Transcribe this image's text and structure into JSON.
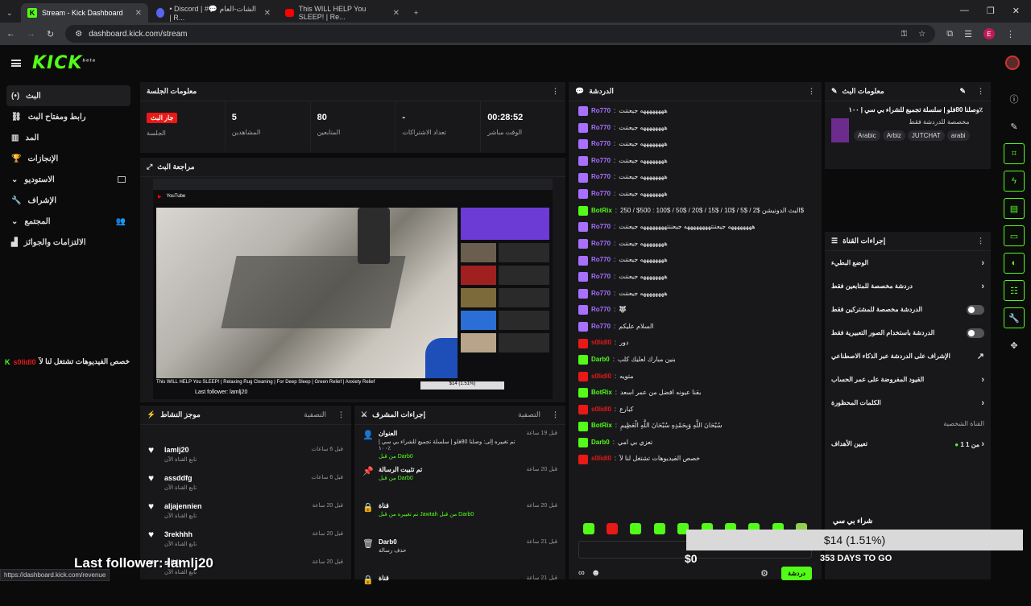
{
  "browser": {
    "tabs": [
      {
        "label": "Stream - Kick Dashboard",
        "favicon": "kick-icon",
        "active": true
      },
      {
        "label": "• Discord | #💬 الشات-العام | R...",
        "favicon": "discord-icon",
        "active": false
      },
      {
        "label": "This WILL HELP You SLEEP! | Re...",
        "favicon": "youtube-icon",
        "active": false
      }
    ],
    "url": "dashboard.kick.com/stream",
    "profile_initial": "E",
    "status_url": "https://dashboard.kick.com/revenue"
  },
  "kick": {
    "logo": "KICK",
    "logo_sup": "beta"
  },
  "nav": {
    "items": [
      {
        "label": "البث",
        "icon": "broadcast-icon",
        "active": true
      },
      {
        "label": "رابط ومفتاح البث",
        "icon": "link-icon"
      },
      {
        "label": "المد",
        "icon": "chart-icon"
      },
      {
        "label": "الإنجازات",
        "icon": "trophy-icon"
      },
      {
        "label": "الاستوديو",
        "icon": "chevron-down-icon"
      },
      {
        "label": "الإشراف",
        "icon": "wrench-icon"
      },
      {
        "label": "المجتمع",
        "icon": "chevron-down-icon"
      },
      {
        "label": "الالتزامات والجوائز",
        "icon": "gift-icon"
      }
    ]
  },
  "overlay": {
    "clip_text": "خصص الفيديوهات تشتغل لنا لآ",
    "clip_user": "s0lidl0",
    "last_follower": "Last follower: lamlj20"
  },
  "session": {
    "title": "معلومات الجلسة",
    "live_badge": "جار البث",
    "stats": [
      {
        "value": "",
        "label": "الجلسة"
      },
      {
        "value": "5",
        "label": "المشاهدين"
      },
      {
        "value": "80",
        "label": "المتابعين"
      },
      {
        "value": "-",
        "label": "تعداد الاشتراكات"
      },
      {
        "value": "00:28:52",
        "label": "الوقت مباشر"
      }
    ]
  },
  "preview": {
    "title": "مراجعة البث",
    "video_title": "This WILL HELP You SLEEP! | Relaxing Rug Cleaning | For Deep Sleep | Green Relief | Anxiety Relief",
    "last_follower_small": "Last follower: lamlj20",
    "donation_small": "$14 (1.51%)"
  },
  "activity": {
    "title": "موجز النشاط",
    "filter": "التصفية",
    "items": [
      {
        "name": "lamlj20",
        "sub": "تابع القناة الآن",
        "time": "قبل 6 ساعات"
      },
      {
        "name": "assddfg",
        "sub": "تابع القناة الآن",
        "time": "قبل 6 ساعات"
      },
      {
        "name": "aljajennien",
        "sub": "تابع القناة الآن",
        "time": "قبل 20 ساعة"
      },
      {
        "name": "3rekhhh",
        "sub": "تابع القناة الآن",
        "time": "قبل 20 ساعة"
      },
      {
        "name": "sill4l",
        "sub": "تابع القناة الآن",
        "time": "قبل 20 ساعة"
      }
    ]
  },
  "mod_actions": {
    "title": "إجراءات المشرف",
    "filter": "التصفية",
    "items": [
      {
        "icon": "user-icon",
        "t1": "العنوان",
        "t2": "تم تغييره إلى: وصلنا 80فلو | سلسلة تجميع للشراء بي سي | ١٠٠٪",
        "t3": "من قبل Darb0",
        "time": "قبل 19 ساعة"
      },
      {
        "icon": "pin-icon",
        "t1": "تم تثبيت الرسالة",
        "t2": "",
        "t3": "من قبل Darb0",
        "time": "قبل 20 ساعة"
      },
      {
        "icon": "lock-icon",
        "t1": "قناة",
        "t2": "",
        "t3": "تم تغييره من قبل Jawtah من قبل Darb0",
        "time": "قبل 20 ساعة"
      },
      {
        "icon": "trash-icon",
        "t1": "Darb0",
        "t2": "حذف رسالة",
        "t3": "",
        "time": "قبل 21 ساعة"
      },
      {
        "icon": "lock-icon",
        "t1": "قناة",
        "t2": "",
        "t3": "",
        "time": "قبل 21 ساعة"
      }
    ]
  },
  "chat": {
    "title": "الدردشة",
    "messages": [
      {
        "user": "Ro770",
        "text": "ههههههههه جيعننت",
        "color": "#a970ff"
      },
      {
        "user": "Ro770",
        "text": "ههههههههه جيعننت",
        "color": "#a970ff"
      },
      {
        "user": "Ro770",
        "text": "ههههههههه جيعننت",
        "color": "#a970ff"
      },
      {
        "user": "Ro770",
        "text": "ههههههههه جيعننت",
        "color": "#a970ff"
      },
      {
        "user": "Ro770",
        "text": "ههههههههه جيعننت",
        "color": "#a970ff"
      },
      {
        "user": "Ro770",
        "text": "ههههههههه جيعننت",
        "color": "#a970ff"
      },
      {
        "user": "BotRix",
        "text": "البث الدونيشن $2 / $5 / $10 / $15 / $20 / $50 / $100 : 500$ / 250$",
        "color": "#53fc18"
      },
      {
        "user": "Ro770",
        "text": "ههههههههه جيعننتههههههههه جيعننتههههههههه جيعننت",
        "color": "#a970ff"
      },
      {
        "user": "Ro770",
        "text": "ههههههههه جيعننت",
        "color": "#a970ff"
      },
      {
        "user": "Ro770",
        "text": "ههههههههه جيعننت",
        "color": "#a970ff"
      },
      {
        "user": "Ro770",
        "text": "ههههههههه جيعننت",
        "color": "#a970ff"
      },
      {
        "user": "Ro770",
        "text": "ههههههههه جيعننت",
        "color": "#a970ff"
      },
      {
        "user": "Ro770",
        "text": "🐺",
        "color": "#a970ff"
      },
      {
        "user": "Ro770",
        "text": "السلام عليكم",
        "color": "#a970ff"
      },
      {
        "user": "s0lidl0",
        "text": "دور",
        "color": "#e91916"
      },
      {
        "user": "Darb0",
        "text": "بنين مبارك لعليك كلب",
        "color": "#53fc18"
      },
      {
        "user": "s0lidl0",
        "text": "متويه",
        "color": "#e91916"
      },
      {
        "user": "BotRix",
        "text": "بقنا عيونه افضل من عمر اسعد",
        "color": "#53fc18"
      },
      {
        "user": "s0lidl0",
        "text": "كبارع",
        "color": "#e91916"
      },
      {
        "user": "BotRix",
        "text": "سُبْحَانَ اللَّهِ وَبِحَمْدِهِ سُبْحَانَ اللَّهِ الْعَظِيمِ",
        "color": "#53fc18"
      },
      {
        "user": "Darb0",
        "text": "تعزي بي امي",
        "color": "#53fc18"
      },
      {
        "user": "s0lidl0",
        "text": "خصص الفيديوهات تشتغل لنا لآ",
        "color": "#e91916"
      }
    ],
    "send_label": "دردشة"
  },
  "stream_info": {
    "title": "معلومات البث",
    "stream_title": "وصلنا 80فلو | سلسلة تجميع للشراء بي سي | ١٠٠٪",
    "category": "مخصصة للدردشة فقط",
    "tags": [
      "Arabic",
      "Arbiz",
      "JUTCHAT",
      "arabi"
    ]
  },
  "channel_actions": {
    "title": "إجراءات القناة",
    "rows": [
      {
        "label": "الوضع البطيء",
        "control": "chevron"
      },
      {
        "label": "دردشة مخصصة للمتابعين فقط",
        "control": "chevron"
      },
      {
        "label": "الدردشة مخصصة للمشتركين فقط",
        "control": "toggle"
      },
      {
        "label": "الدردشة باستخدام الصور التعبيرية فقط",
        "control": "toggle"
      },
      {
        "label": "الإشراف على الدردشة عبر الذكاء الاصطناعي",
        "control": "external"
      },
      {
        "label": "القيود المفروضة على عمر الحساب",
        "control": "chevron"
      },
      {
        "label": "الكلمات المحظورة",
        "control": "chevron"
      }
    ],
    "shortcut_label": "القناة الشخصية",
    "goals_label": "تعيين الأهداف",
    "goals_value": "1 من 1"
  },
  "donation": {
    "amount": "$14 (1.51%)",
    "current": "$0",
    "days": "353 DAYS TO GO",
    "goal_title": "شراء بي سي"
  }
}
